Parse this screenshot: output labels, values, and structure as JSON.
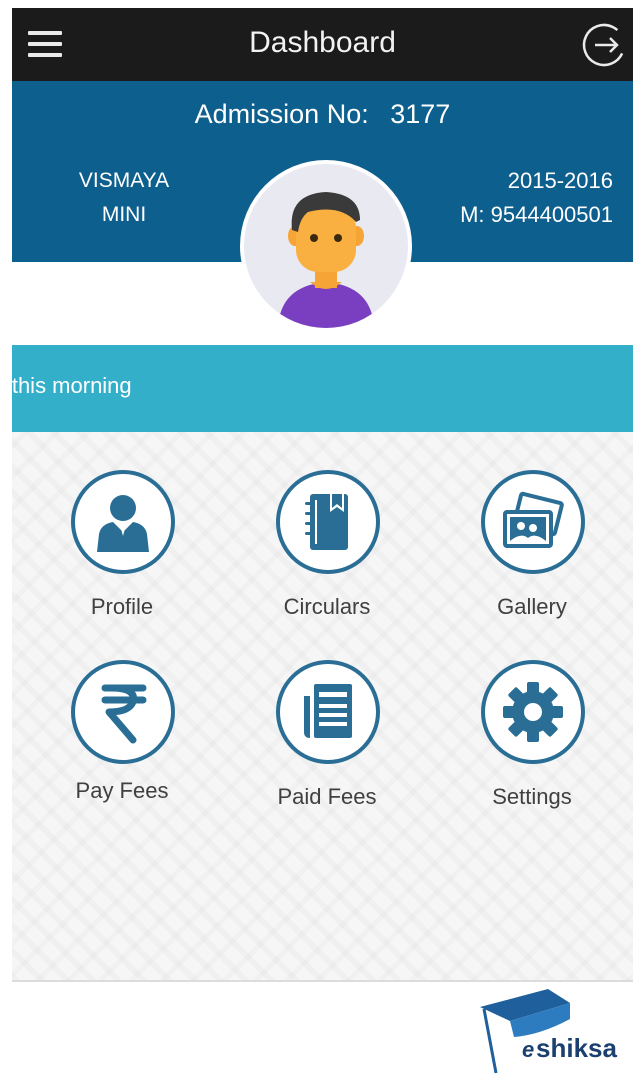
{
  "header": {
    "title": "Dashboard"
  },
  "student": {
    "admission_label": "Admission No:",
    "admission_no": "3177",
    "first_name": "VISMAYA",
    "last_name": "MINI",
    "year": "2015-2016",
    "mobile": "M: 9544400501"
  },
  "ticker": {
    "text": "this morning"
  },
  "menu": [
    {
      "label": "Profile",
      "icon": "profile-icon"
    },
    {
      "label": "Circulars",
      "icon": "circulars-icon"
    },
    {
      "label": "Gallery",
      "icon": "gallery-icon"
    },
    {
      "label": "Pay Fees",
      "icon": "rupee-icon"
    },
    {
      "label": "Paid Fees",
      "icon": "receipt-icon"
    },
    {
      "label": "Settings",
      "icon": "gear-icon"
    }
  ],
  "brand": {
    "logo_text_e": "e",
    "logo_text_rest": "shiksa"
  },
  "colors": {
    "topbar": "#1b1b1b",
    "header_band": "#0d5f8d",
    "ticker_band": "#34afc9",
    "icon_blue": "#2a6e96"
  }
}
